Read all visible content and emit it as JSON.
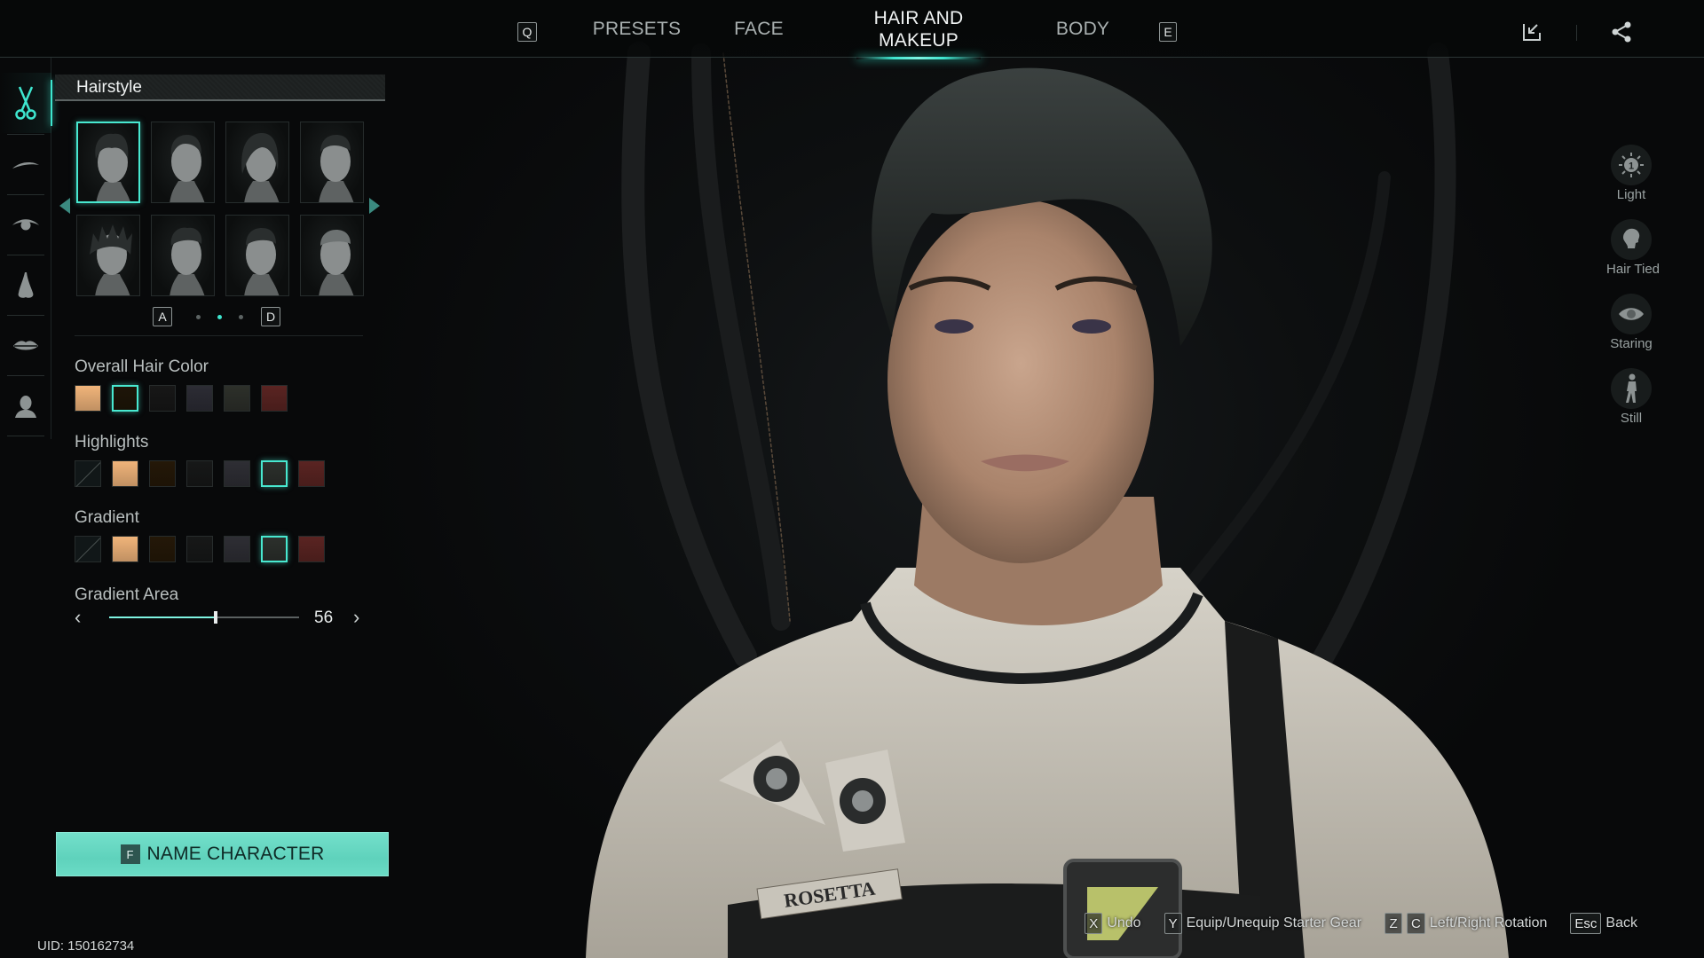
{
  "topbar": {
    "prev_key": "Q",
    "next_key": "E",
    "tabs": [
      {
        "label": "PRESETS",
        "active": false
      },
      {
        "label": "FACE",
        "active": false
      },
      {
        "label": "HAIR AND MAKEUP",
        "active": true
      },
      {
        "label": "BODY",
        "active": false
      }
    ],
    "actions": [
      {
        "icon": "import-icon"
      },
      {
        "icon": "share-icon"
      }
    ]
  },
  "rail": {
    "items": [
      {
        "icon": "scissors-icon",
        "category": "hair",
        "active": true
      },
      {
        "icon": "eyebrow-icon",
        "category": "eyebrows",
        "active": false
      },
      {
        "icon": "eye-icon",
        "category": "eyes",
        "active": false
      },
      {
        "icon": "nose-icon",
        "category": "nose",
        "active": false
      },
      {
        "icon": "lips-icon",
        "category": "lips",
        "active": false
      },
      {
        "icon": "head-silhouette-icon",
        "category": "profile",
        "active": false
      }
    ]
  },
  "panel": {
    "title": "Hairstyle",
    "hairstyles": [
      {
        "style": "tousled-medium",
        "selected": true
      },
      {
        "style": "slicked-back",
        "selected": false
      },
      {
        "style": "long-swept",
        "selected": false
      },
      {
        "style": "undercut-short",
        "selected": false
      },
      {
        "style": "twists",
        "selected": false
      },
      {
        "style": "curly-fade",
        "selected": false
      },
      {
        "style": "textured-crop",
        "selected": false
      },
      {
        "style": "buzz-cut",
        "selected": false
      }
    ],
    "pager": {
      "prev_key": "A",
      "next_key": "D",
      "pages": 3,
      "current_page": 2
    },
    "overall_hair_color": {
      "label": "Overall Hair Color",
      "swatches": [
        {
          "color": "#f0b47a",
          "selected": false
        },
        {
          "color": "#1e1508",
          "selected": true
        },
        {
          "color": "#171717",
          "selected": false
        },
        {
          "color": "#2c2c34",
          "selected": false
        },
        {
          "color": "#2d302a",
          "selected": false
        },
        {
          "color": "#5a2422",
          "selected": false
        }
      ]
    },
    "highlights": {
      "label": "Highlights",
      "swatches": [
        {
          "color": "none",
          "selected": false
        },
        {
          "color": "#f0b47a",
          "selected": false
        },
        {
          "color": "#241808",
          "selected": false
        },
        {
          "color": "#171818",
          "selected": false
        },
        {
          "color": "#2e2e34",
          "selected": false
        },
        {
          "color": "#2c302c",
          "selected": true
        },
        {
          "color": "#5a2422",
          "selected": false
        }
      ]
    },
    "gradient": {
      "label": "Gradient",
      "swatches": [
        {
          "color": "none",
          "selected": false
        },
        {
          "color": "#f0b47a",
          "selected": false
        },
        {
          "color": "#241808",
          "selected": false
        },
        {
          "color": "#171818",
          "selected": false
        },
        {
          "color": "#2e2e34",
          "selected": false
        },
        {
          "color": "#2c302c",
          "selected": true
        },
        {
          "color": "#5a2422",
          "selected": false
        }
      ]
    },
    "gradient_area": {
      "label": "Gradient Area",
      "value": 56,
      "min": 0,
      "max": 100
    }
  },
  "name_button": {
    "key": "F",
    "label": "NAME CHARACTER"
  },
  "uid": "UID: 150162734",
  "side_actions": [
    {
      "icon": "light-icon",
      "label": "Light",
      "badge": "1"
    },
    {
      "icon": "hair-tied-icon",
      "label": "Hair Tied"
    },
    {
      "icon": "eye-icon",
      "label": "Staring"
    },
    {
      "icon": "pose-icon",
      "label": "Still"
    }
  ],
  "hints": [
    {
      "keys": [
        "X"
      ],
      "label": "Undo"
    },
    {
      "keys": [
        "Y"
      ],
      "label": "Equip/Unequip Starter Gear"
    },
    {
      "keys": [
        "Z",
        "C"
      ],
      "label": "Left/Right Rotation"
    },
    {
      "keys": [
        "Esc"
      ],
      "label": "Back"
    }
  ],
  "character": {
    "name_tag": "ROSETTA"
  },
  "colors": {
    "accent": "#3ee6cf",
    "button": "#66d8c2",
    "background": "#0a0c0d"
  }
}
